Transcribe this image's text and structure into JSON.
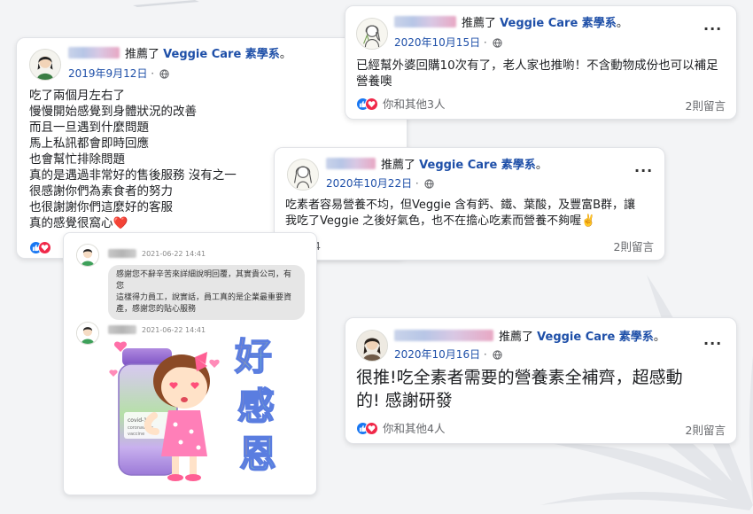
{
  "colors": {
    "page_link": "#1e4fa8",
    "like_blue": "#1877f2",
    "love_red": "#f02849",
    "muted_gray": "#65676b"
  },
  "post1": {
    "recommend": "推薦了",
    "page": "Veggie Care 素學系",
    "suffix": "。",
    "date": "2019年9月12日",
    "date_sep": " · ",
    "text": "吃了兩個月左右了\n慢慢開始感覺到身體狀況的改善\n而且一旦遇到什麼問題\n馬上私訊都會即時回應\n也會幫忙排除問題\n真的是遇過非常好的售後服務 沒有之一\n很感謝你們為素食者的努力\n也很謝謝你們這麼好的客服\n真的感覺很窩心❤️",
    "more": "···"
  },
  "post2": {
    "recommend": "推薦了",
    "page": "Veggie Care 素學系",
    "suffix": "。",
    "date": "2020年10月15日",
    "date_sep": " · ",
    "text": "已經幫外婆回購10次有了，老人家也推喲！不含動物成份也可以補足\n營養噢",
    "reactions": "你和其他3人",
    "comments": "2則留言",
    "more": "···"
  },
  "post3": {
    "recommend": "推薦了",
    "page": "Veggie Care 素學系",
    "suffix": "。",
    "date": "2020年10月22日",
    "date_sep": " · ",
    "text": "吃素者容易營養不均，但Veggie 含有鈣、鐵、葉酸，及豐富B群，讓\n我吃了Veggie 之後好氣色，也不在擔心吃素而營養不夠喔✌️",
    "reactions": "4",
    "comments": "2則留言",
    "more": "···"
  },
  "post4": {
    "recommend": "推薦了",
    "page": "Veggie Care 素學系",
    "suffix": "。",
    "date": "2020年10月16日",
    "date_sep": " · ",
    "text": "很推!吃全素者需要的營養素全補齊，超感動\n的! 感謝研發",
    "reactions": "你和其他4人",
    "comments": "2則留言",
    "more": "···"
  },
  "chat": {
    "msg1_time": "2021-06-22 14:41",
    "msg1_text": "感謝您不辭辛苦來詳細說明回覆，其實貴公司，有您\n這樣得力員工，說實話，員工真的是企業最重要資\n產，感謝您的貼心服務",
    "msg2_time": "2021-06-22 14:41",
    "sticker_text": "好感恩",
    "bottle_label": "covid-19 coronavirus vaccine",
    "icon": "sticker-girl-hugging-bottle"
  }
}
